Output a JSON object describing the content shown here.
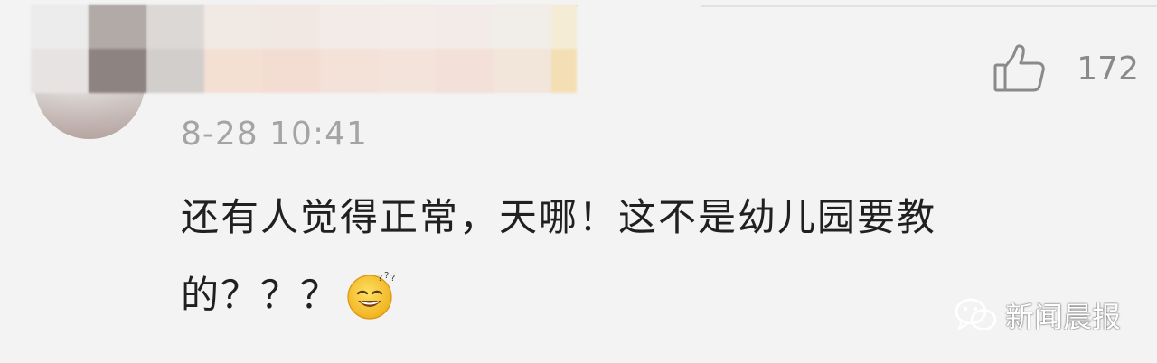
{
  "comment": {
    "username": "",
    "timestamp": "8-28 10:41",
    "likes": "172",
    "text": "还有人觉得正常，天哪！这不是幼儿园要教的？？？",
    "emoji": "dizzy-smile-emoji"
  },
  "icons": {
    "like": "thumbs-up-icon",
    "wechat": "wechat-icon"
  },
  "watermark": {
    "label": "新闻晨报"
  },
  "colors": {
    "background": "#f3f3f3",
    "timestamp": "#a4a4a4",
    "text": "#202020",
    "like": "#8a8a8a",
    "emoji_face": "#f7c52e"
  }
}
